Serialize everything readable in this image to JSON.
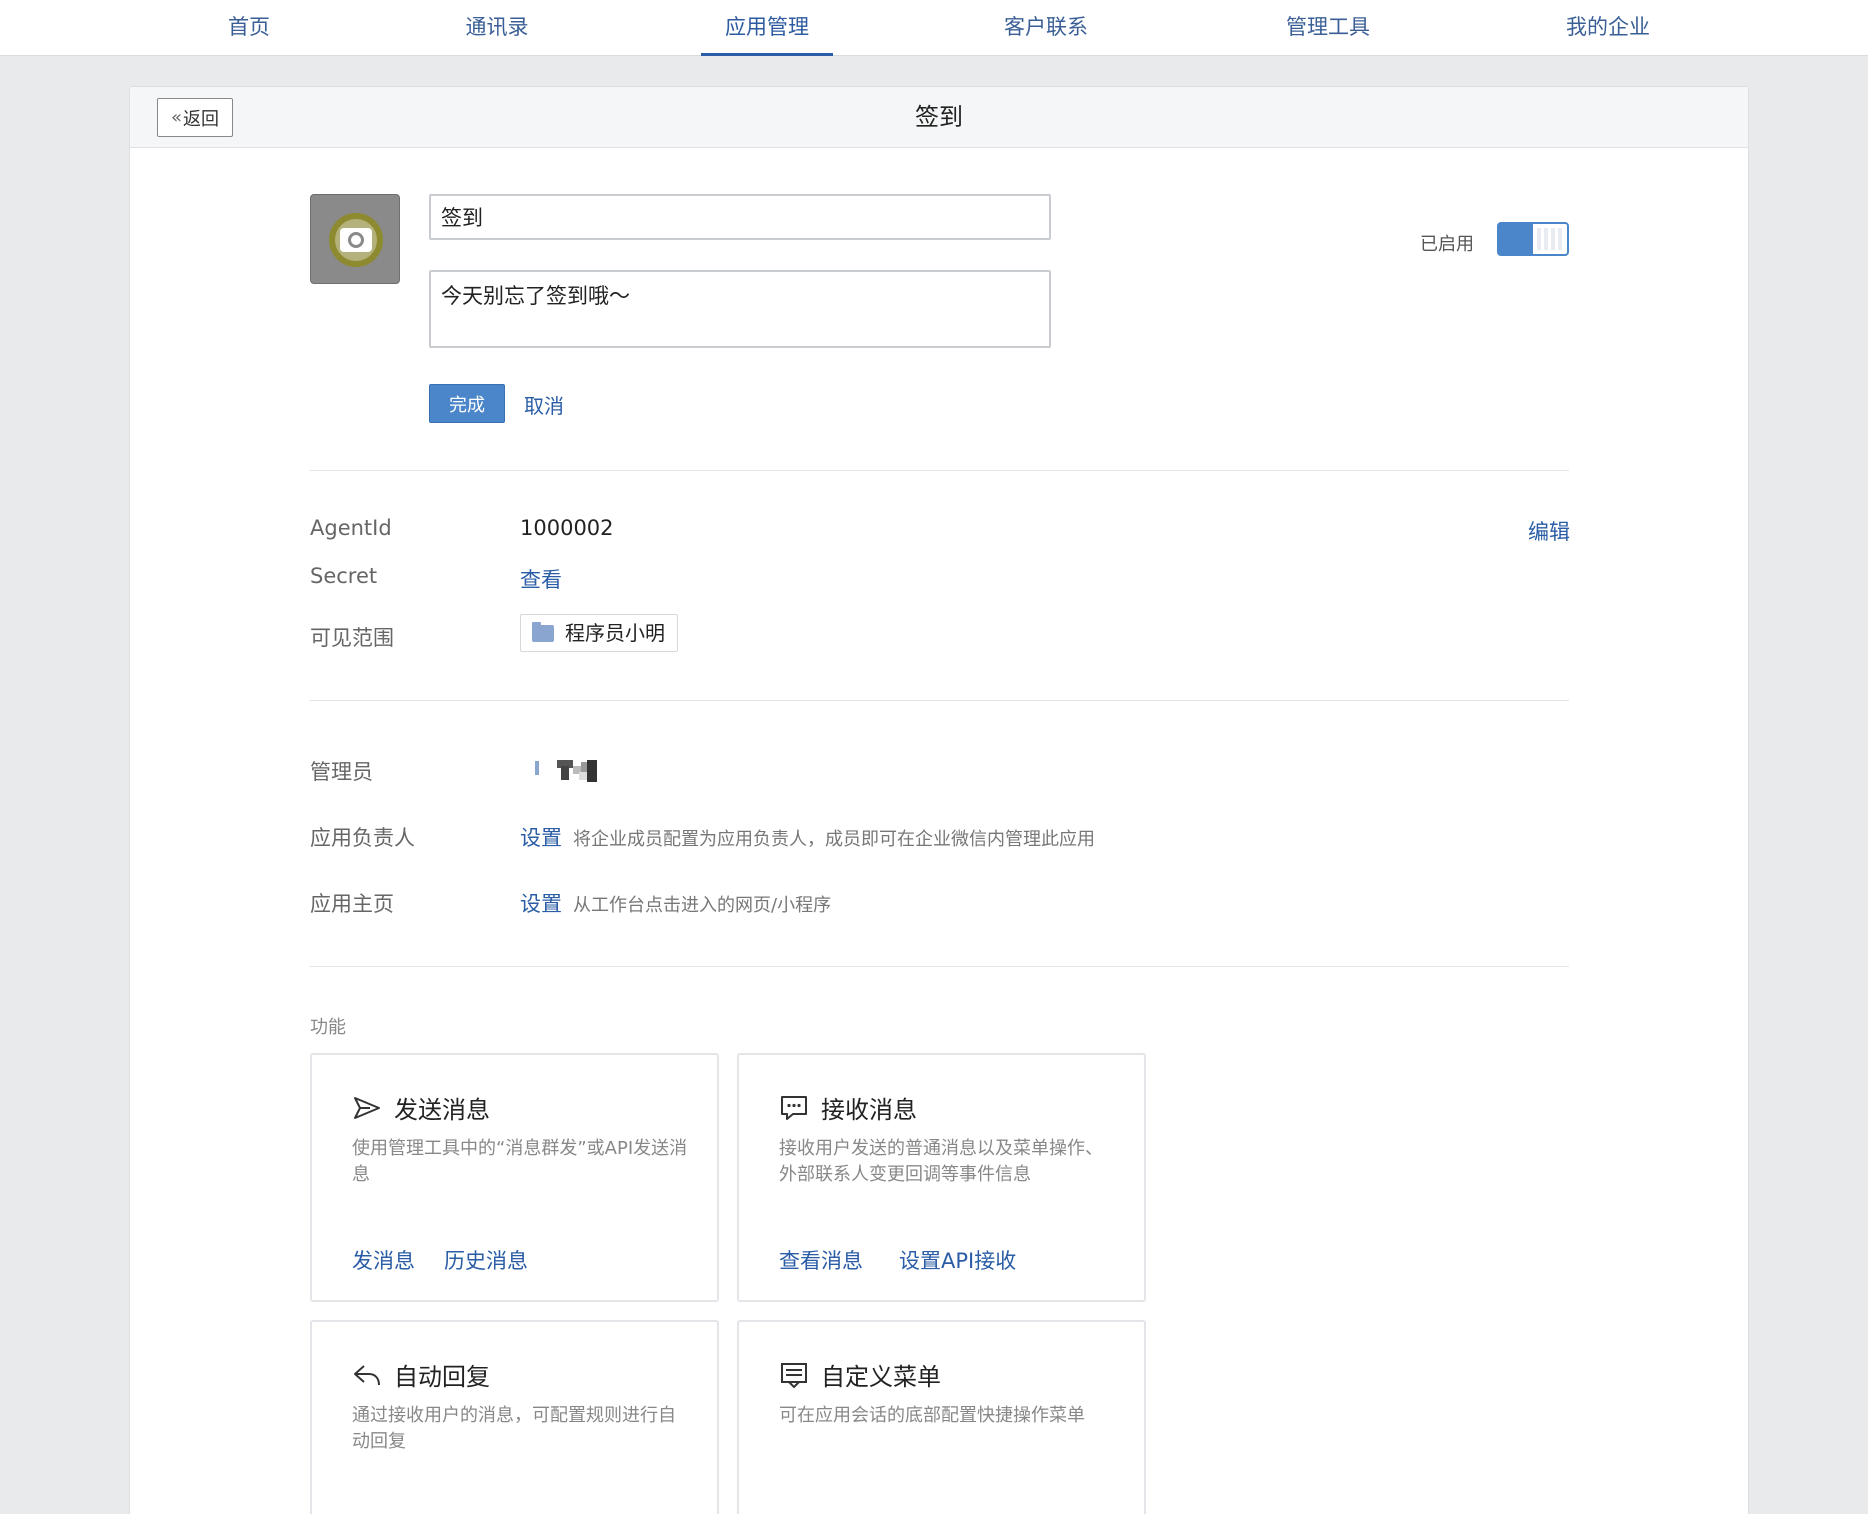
{
  "nav": {
    "tabs": [
      {
        "label": "首页"
      },
      {
        "label": "通讯录"
      },
      {
        "label": "应用管理",
        "active": true
      },
      {
        "label": "客户联系"
      },
      {
        "label": "管理工具"
      },
      {
        "label": "我的企业"
      }
    ]
  },
  "header": {
    "back_label": "返回",
    "title": "签到"
  },
  "app": {
    "icon": "camera-icon",
    "name_value": "签到",
    "description_value": "今天别忘了签到哦～",
    "done_label": "完成",
    "cancel_label": "取消",
    "status_label": "已启用",
    "enabled": true
  },
  "info": {
    "agentid_label": "AgentId",
    "agentid_value": "1000002",
    "edit_label": "编辑",
    "secret_label": "Secret",
    "secret_view_label": "查看",
    "scope_label": "可见范围",
    "scope_tag": "程序员小明"
  },
  "admin": {
    "admin_label": "管理员",
    "owner_label": "应用负责人",
    "owner_set_label": "设置",
    "owner_hint": "将企业成员配置为应用负责人，成员即可在企业微信内管理此应用",
    "homepage_label": "应用主页",
    "homepage_set_label": "设置",
    "homepage_hint": "从工作台点击进入的网页/小程序"
  },
  "features": {
    "section_title": "功能",
    "cards": [
      {
        "icon": "send-icon",
        "title": "发送消息",
        "desc": "使用管理工具中的“消息群发”或API发送消息",
        "links": [
          "发消息",
          "历史消息"
        ]
      },
      {
        "icon": "chat-icon",
        "title": "接收消息",
        "desc": "接收用户发送的普通消息以及菜单操作、外部联系人变更回调等事件信息",
        "links": [
          "查看消息",
          "设置API接收"
        ]
      },
      {
        "icon": "reply-icon",
        "title": "自动回复",
        "desc": "通过接收用户的消息，可配置规则进行自动回复",
        "links": []
      },
      {
        "icon": "menu-icon",
        "title": "自定义菜单",
        "desc": "可在应用会话的底部配置快捷操作菜单",
        "links": []
      }
    ]
  }
}
